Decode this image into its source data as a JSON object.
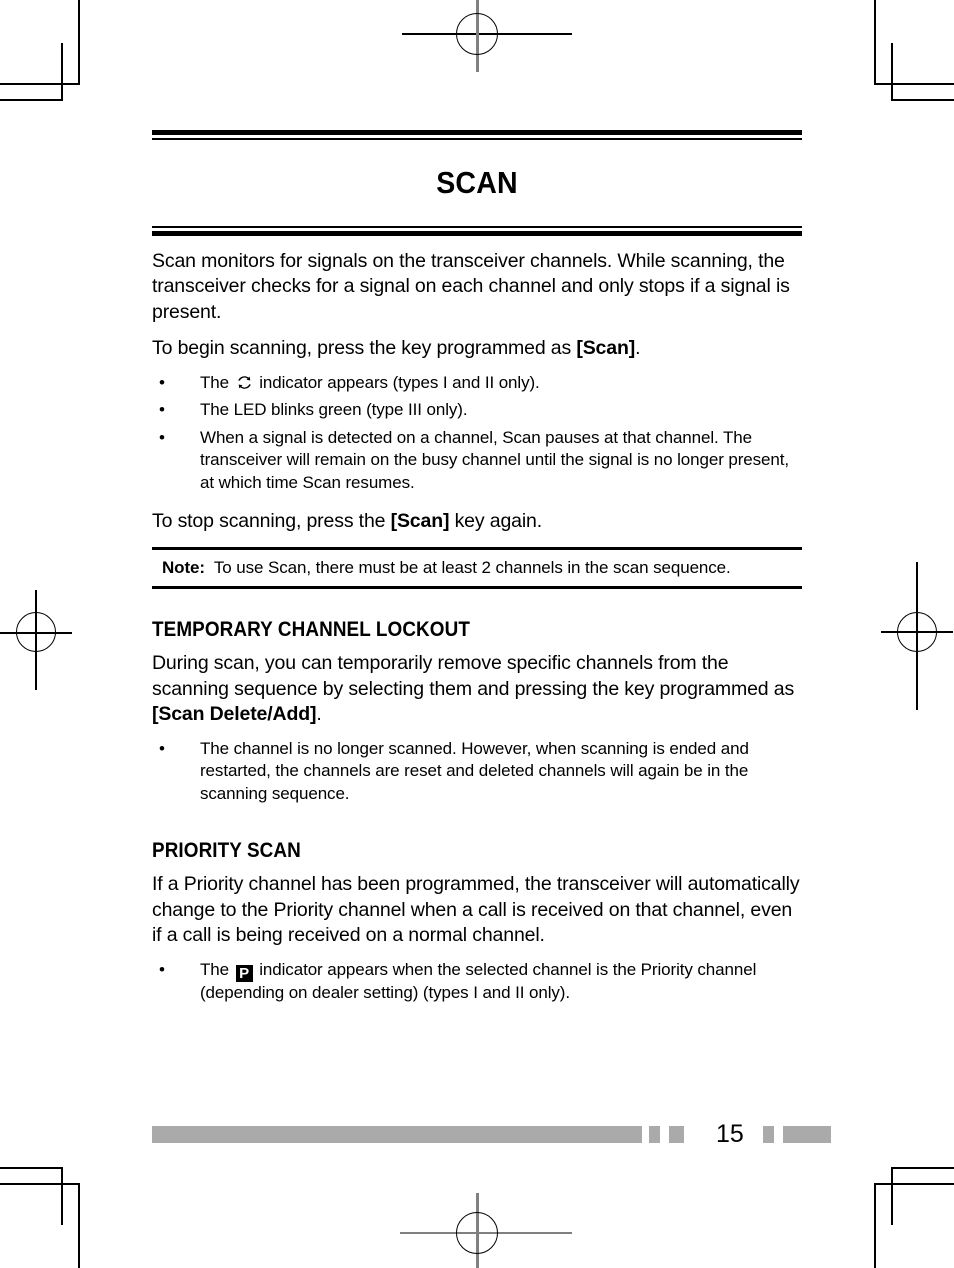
{
  "document": {
    "type": "printed-manual-page",
    "page_number": "15"
  },
  "chapter": {
    "title": "SCAN"
  },
  "intro": {
    "paragraph1": "Scan monitors for signals on the transceiver channels.  While scanning, the transceiver checks for a signal on each channel and only stops if a signal is present.",
    "paragraph2_prefix": "To begin scanning, press the key programmed as ",
    "paragraph2_key": "[Scan]",
    "paragraph2_suffix": ".",
    "paragraph3_prefix": "To stop scanning, press the ",
    "paragraph3_key": "[Scan]",
    "paragraph3_suffix": " key again."
  },
  "bullets_scan": [
    {
      "before_icon": "The ",
      "icon": "scan-loop-icon",
      "after_icon": " indicator appears (types I and II only)."
    },
    {
      "text": "The LED blinks green (type III only)."
    },
    {
      "text": "When a signal is detected on a channel, Scan pauses at that channel.  The transceiver will remain on the busy channel until the signal is no longer present, at which time Scan resumes."
    }
  ],
  "note": {
    "label": "Note:",
    "text": "To use Scan, there must be at least 2 channels in the scan sequence."
  },
  "section_lockout": {
    "heading": "TEMPORARY CHANNEL LOCKOUT",
    "paragraph_prefix": "During scan, you can temporarily remove specific channels from the scanning sequence by selecting them and pressing the key programmed as ",
    "paragraph_key": "[Scan Delete/Add]",
    "paragraph_suffix": ".",
    "bullets": [
      {
        "text": "The channel is no longer scanned. However, when scanning is ended and restarted, the channels are reset and deleted channels will again be in the scanning sequence."
      }
    ]
  },
  "section_priority": {
    "heading": "PRIORITY SCAN",
    "paragraph": "If a Priority channel has been programmed, the transceiver will automatically change to the Priority channel when a call is received on that channel, even if a call is being received on a normal channel.",
    "bullets": [
      {
        "before_icon": "The ",
        "icon": "priority-p-icon",
        "icon_glyph": "P",
        "after_icon": " indicator appears when the selected channel is the Priority channel (depending on dealer setting) (types I and II only)."
      }
    ]
  },
  "footer": {
    "page_number": "15",
    "bar_color": "#aaaaaa"
  },
  "print_marks": {
    "crop_mark_color": "#000000",
    "registration_gray": "#808080"
  }
}
